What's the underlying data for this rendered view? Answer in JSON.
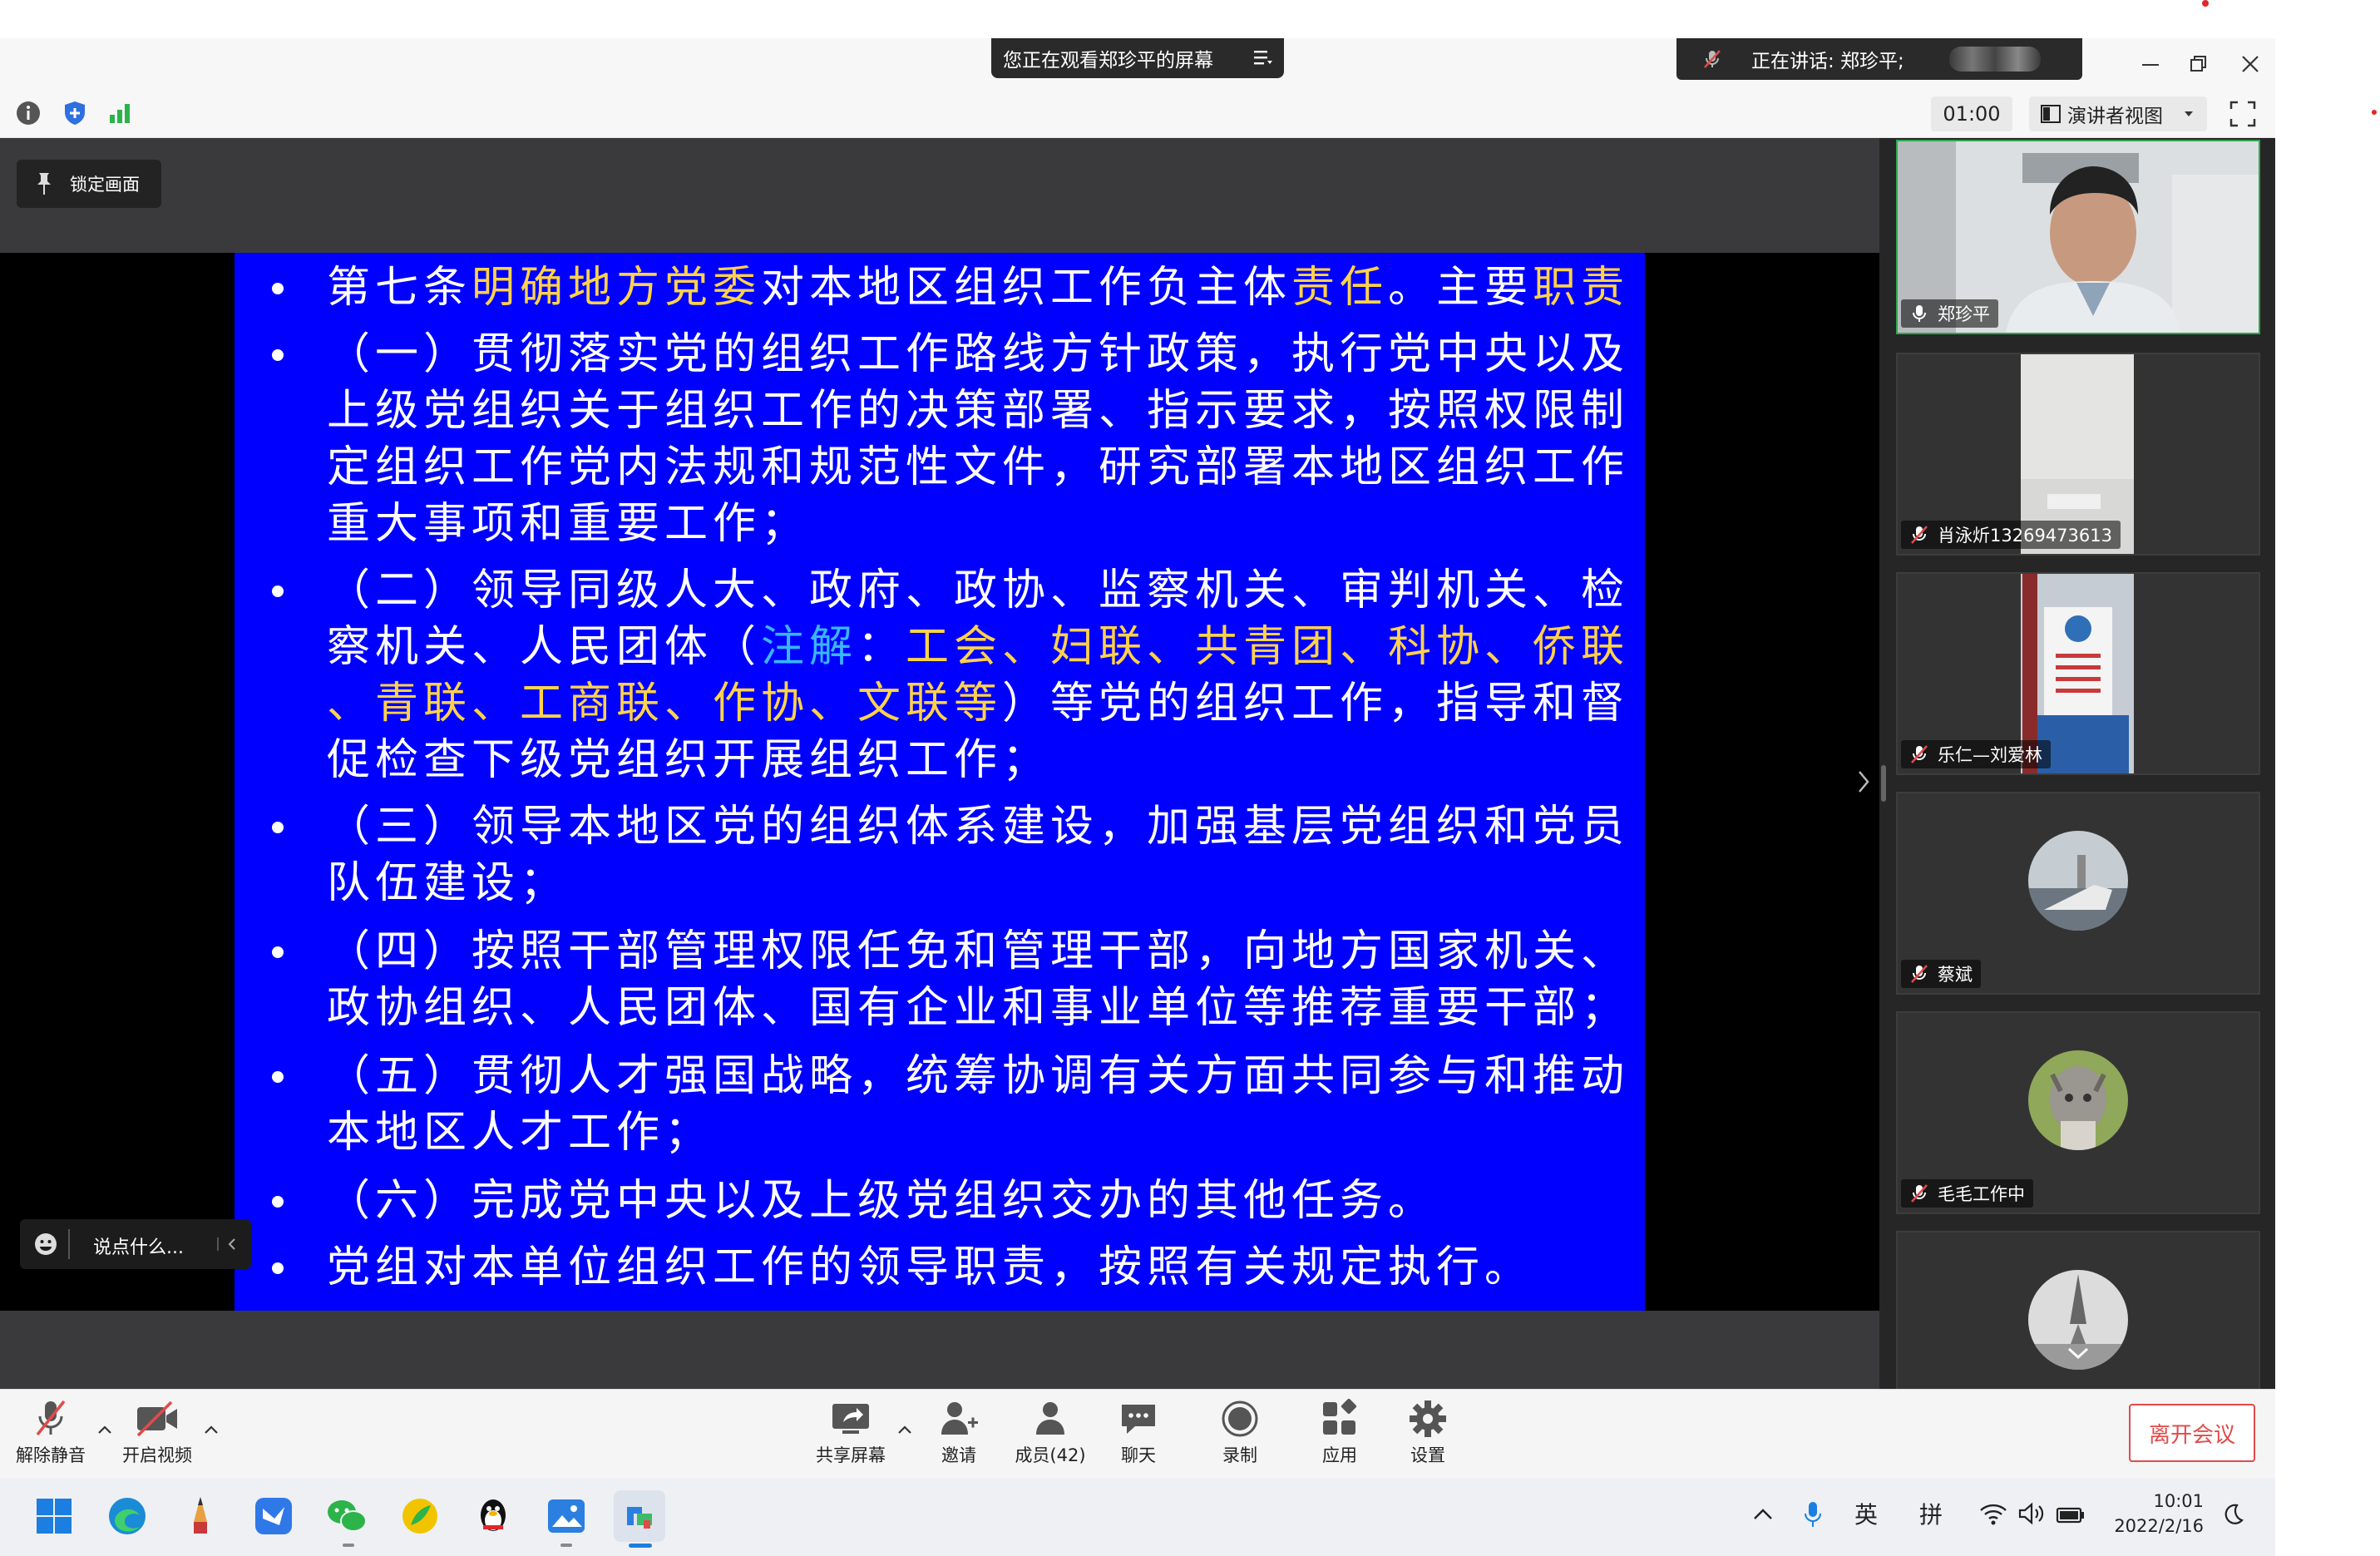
{
  "window": {
    "viewing_banner": "您正在观看郑珍平的屏幕",
    "speaking_label": "正在讲话: 郑珍平;"
  },
  "toolbar": {
    "timer": "01:00",
    "view_mode": "演讲者视图"
  },
  "stage": {
    "lock_label": "锁定画面",
    "chat_placeholder": "说点什么..."
  },
  "slide": {
    "lines": [
      [
        "第七条",
        "明确地方党委",
        "对本地区组织工作负主体",
        "责任",
        "。主要",
        "职责"
      ],
      [
        "（一）贯彻落实党的组织工作路线方针政策，执行党中央以及"
      ],
      [
        "上级党组织关于组织工作的决策部署、指示要求，按照权限制"
      ],
      [
        "定组织工作党内法规和规范性文件，研究部署本地区组织工作"
      ],
      [
        "重大事项和重要工作；"
      ],
      [
        "（二）领导同级人大、政府、政协、监察机关、审判机关、检"
      ],
      [
        "察机关、人民团体（",
        "注解",
        "：",
        "工会、妇联、共青团、科协、侨联"
      ],
      [
        "、青联、工商联、作协、文联等",
        "）等党的组织工作，指导和督"
      ],
      [
        "促检查下级党组织开展组织工作；"
      ],
      [
        "（三）领导本地区党的组织体系建设，加强基层党组织和党员"
      ],
      [
        "队伍建设；"
      ],
      [
        "（四）按照干部管理权限任免和管理干部，向地方国家机关、"
      ],
      [
        "政协组织、人民团体、国有企业和事业单位等推荐重要干部；"
      ],
      [
        "（五）贯彻人才强国战略，统筹协调有关方面共同参与和推动"
      ],
      [
        "本地区人才工作；"
      ],
      [
        "（六）完成党中央以及上级党组织交办的其他任务。"
      ],
      [
        "党组对本单位组织工作的领导职责，按照有关规定执行。"
      ]
    ]
  },
  "participants": [
    {
      "name": "郑珍平",
      "muted": false
    },
    {
      "name": "肖泳炘13269473613",
      "muted": true
    },
    {
      "name": "乐仁—刘爱林",
      "muted": true
    },
    {
      "name": "蔡斌",
      "muted": true
    },
    {
      "name": "毛毛工作中",
      "muted": true
    },
    {
      "name": "",
      "muted": true
    }
  ],
  "bottom_toolbar": {
    "unmute": "解除静音",
    "start_video": "开启视频",
    "share_screen": "共享屏幕",
    "invite": "邀请",
    "members": "成员(42)",
    "chat": "聊天",
    "record": "录制",
    "apps": "应用",
    "settings": "设置",
    "leave": "离开会议"
  },
  "taskbar": {
    "ime_lang": "英",
    "ime_mode": "拼",
    "time": "10:01",
    "date": "2022/2/16"
  },
  "colors": {
    "slide_bg": "#0000ff",
    "highlight_yellow": "#ffd24a",
    "highlight_cyan": "#38b6ff",
    "leave_red": "#e24a4a"
  }
}
